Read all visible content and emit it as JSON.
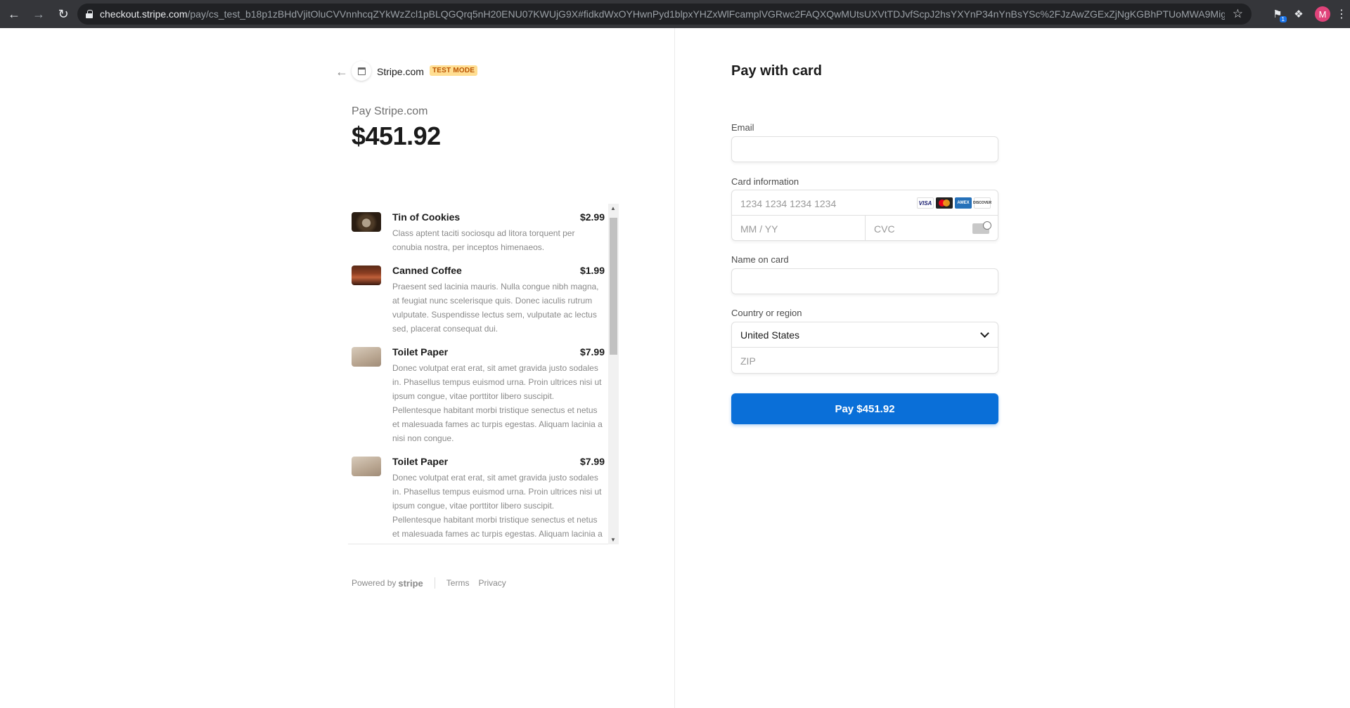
{
  "browser": {
    "url_host": "checkout.stripe.com",
    "url_path": "/pay/cs_test_b18p1zBHdVjitOluCVVnnhcqZYkWzZcl1pBLQGQrq5nH20ENU07KWUjG9X#fidkdWxOYHwnPyd1blpxYHZxWlFcamplVGRwc2FAQXQwMUtsUXVtTDJvfScpJ2hsYXYnP34nYnBsYSc%2FJzAwZGExZjNgKGBhPTUoMWA9Mig8ZzE3KDY...",
    "avatar_letter": "M",
    "ext_badge": "1"
  },
  "merchant": {
    "name": "Stripe.com",
    "test_badge": "TEST MODE"
  },
  "summary": {
    "pay_label": "Pay Stripe.com",
    "amount": "$451.92"
  },
  "items": [
    {
      "name": "Tin of Cookies",
      "price": "$2.99",
      "description": "Class aptent taciti sociosqu ad litora torquent per conubia nostra, per inceptos himenaeos.",
      "thumb": "cookies"
    },
    {
      "name": "Canned Coffee",
      "price": "$1.99",
      "description": "Praesent sed lacinia mauris. Nulla congue nibh magna, at feugiat nunc scelerisque quis. Donec iaculis rutrum vulputate. Suspendisse lectus sem, vulputate ac lectus sed, placerat consequat dui.",
      "thumb": "coffee"
    },
    {
      "name": "Toilet Paper",
      "price": "$7.99",
      "description": "Donec volutpat erat erat, sit amet gravida justo sodales in. Phasellus tempus euismod urna. Proin ultrices nisi ut ipsum congue, vitae porttitor libero suscipit. Pellentesque habitant morbi tristique senectus et netus et malesuada fames ac turpis egestas. Aliquam lacinia a nisi non congue.",
      "thumb": "paper"
    },
    {
      "name": "Toilet Paper",
      "price": "$7.99",
      "description": "Donec volutpat erat erat, sit amet gravida justo sodales in. Phasellus tempus euismod urna. Proin ultrices nisi ut ipsum congue, vitae porttitor libero suscipit. Pellentesque habitant morbi tristique senectus et netus et malesuada fames ac turpis egestas. Aliquam lacinia a nisi non congue.",
      "thumb": "paper"
    }
  ],
  "footer": {
    "powered_by": "Powered by",
    "brand": "stripe",
    "terms": "Terms",
    "privacy": "Privacy"
  },
  "form": {
    "title": "Pay with card",
    "email_label": "Email",
    "email_value": "",
    "card_label": "Card information",
    "card_number_placeholder": "1234 1234 1234 1234",
    "expiry_placeholder": "MM / YY",
    "cvc_placeholder": "CVC",
    "card_brands": [
      "VISA",
      "MC",
      "AMEX",
      "DISCOVER"
    ],
    "name_label": "Name on card",
    "country_label": "Country or region",
    "country_value": "United States",
    "zip_placeholder": "ZIP",
    "pay_button": "Pay $451.92"
  },
  "colors": {
    "accent": "#0a6fd8",
    "test_badge_bg": "#ffde92",
    "test_badge_text": "#bb5504"
  }
}
